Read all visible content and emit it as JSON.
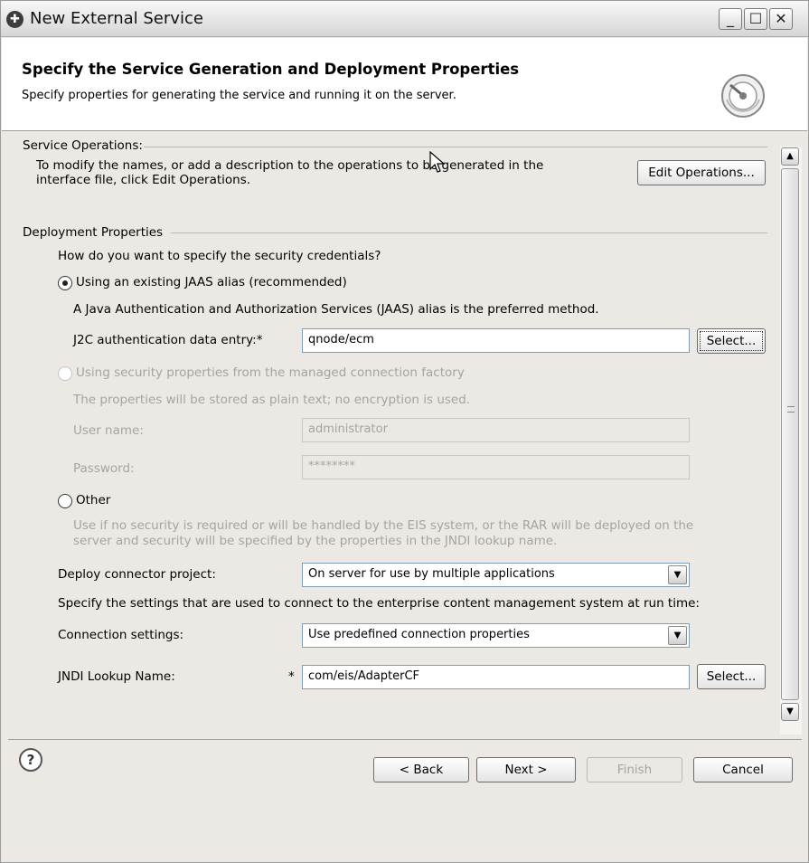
{
  "window": {
    "title": "New External Service",
    "minimize_icon": "minimize-icon",
    "maximize_icon": "maximize-icon",
    "close_icon": "close-icon"
  },
  "header": {
    "title": "Specify the Service Generation and Deployment Properties",
    "description": "Specify properties for generating the service and running it on the server."
  },
  "service_operations": {
    "section_label": "Service Operations:",
    "description_line1": "To modify the names, or add a description to the operations to be generated in the",
    "description_line2": "interface file, click Edit Operations.",
    "edit_button": "Edit Operations..."
  },
  "deployment": {
    "section_label": "Deployment Properties",
    "question": "How do you want to specify the security credentials?",
    "jaas": {
      "label": "Using an existing JAAS alias (recommended)",
      "selected": true,
      "description": "A Java Authentication and Authorization Services (JAAS) alias is the preferred method.",
      "field_label": "J2C authentication data entry:",
      "required_marker": "*",
      "value": "qnode/ecm",
      "select_button": "Select..."
    },
    "managed": {
      "label": "Using security properties from the managed connection factory",
      "selected": false,
      "description": "The properties will be stored as plain text; no encryption is used.",
      "user_label": "User name:",
      "user_value": "administrator",
      "password_label": "Password:",
      "password_value": "********"
    },
    "other": {
      "label": "Other",
      "selected": false,
      "description_line1": "Use if no security is required or will be handled by the EIS system, or the RAR will be deployed on the",
      "description_line2": "server and security will be specified by the properties in the JNDI lookup name."
    },
    "deploy_connector": {
      "label": "Deploy connector project:",
      "value": "On server for use by multiple applications"
    },
    "settings_note": "Specify the settings that are used to connect to the enterprise content management system at run time:",
    "connection_settings": {
      "label": "Connection settings:",
      "value": "Use predefined connection properties"
    },
    "jndi": {
      "label": "JNDI Lookup Name:",
      "required_marker": "*",
      "value": "com/eis/AdapterCF",
      "select_button": "Select..."
    }
  },
  "footer": {
    "help_icon": "help-icon",
    "back": "< Back",
    "next": "Next >",
    "finish": "Finish",
    "cancel": "Cancel"
  }
}
